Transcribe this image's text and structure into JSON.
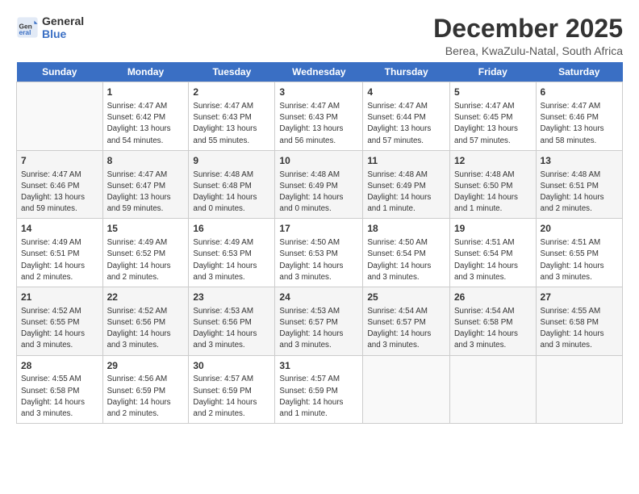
{
  "logo": {
    "line1": "General",
    "line2": "Blue"
  },
  "title": "December 2025",
  "subtitle": "Berea, KwaZulu-Natal, South Africa",
  "days_header": [
    "Sunday",
    "Monday",
    "Tuesday",
    "Wednesday",
    "Thursday",
    "Friday",
    "Saturday"
  ],
  "weeks": [
    [
      {
        "day": "",
        "info": ""
      },
      {
        "day": "1",
        "info": "Sunrise: 4:47 AM\nSunset: 6:42 PM\nDaylight: 13 hours\nand 54 minutes."
      },
      {
        "day": "2",
        "info": "Sunrise: 4:47 AM\nSunset: 6:43 PM\nDaylight: 13 hours\nand 55 minutes."
      },
      {
        "day": "3",
        "info": "Sunrise: 4:47 AM\nSunset: 6:43 PM\nDaylight: 13 hours\nand 56 minutes."
      },
      {
        "day": "4",
        "info": "Sunrise: 4:47 AM\nSunset: 6:44 PM\nDaylight: 13 hours\nand 57 minutes."
      },
      {
        "day": "5",
        "info": "Sunrise: 4:47 AM\nSunset: 6:45 PM\nDaylight: 13 hours\nand 57 minutes."
      },
      {
        "day": "6",
        "info": "Sunrise: 4:47 AM\nSunset: 6:46 PM\nDaylight: 13 hours\nand 58 minutes."
      }
    ],
    [
      {
        "day": "7",
        "info": "Sunrise: 4:47 AM\nSunset: 6:46 PM\nDaylight: 13 hours\nand 59 minutes."
      },
      {
        "day": "8",
        "info": "Sunrise: 4:47 AM\nSunset: 6:47 PM\nDaylight: 13 hours\nand 59 minutes."
      },
      {
        "day": "9",
        "info": "Sunrise: 4:48 AM\nSunset: 6:48 PM\nDaylight: 14 hours\nand 0 minutes."
      },
      {
        "day": "10",
        "info": "Sunrise: 4:48 AM\nSunset: 6:49 PM\nDaylight: 14 hours\nand 0 minutes."
      },
      {
        "day": "11",
        "info": "Sunrise: 4:48 AM\nSunset: 6:49 PM\nDaylight: 14 hours\nand 1 minute."
      },
      {
        "day": "12",
        "info": "Sunrise: 4:48 AM\nSunset: 6:50 PM\nDaylight: 14 hours\nand 1 minute."
      },
      {
        "day": "13",
        "info": "Sunrise: 4:48 AM\nSunset: 6:51 PM\nDaylight: 14 hours\nand 2 minutes."
      }
    ],
    [
      {
        "day": "14",
        "info": "Sunrise: 4:49 AM\nSunset: 6:51 PM\nDaylight: 14 hours\nand 2 minutes."
      },
      {
        "day": "15",
        "info": "Sunrise: 4:49 AM\nSunset: 6:52 PM\nDaylight: 14 hours\nand 2 minutes."
      },
      {
        "day": "16",
        "info": "Sunrise: 4:49 AM\nSunset: 6:53 PM\nDaylight: 14 hours\nand 3 minutes."
      },
      {
        "day": "17",
        "info": "Sunrise: 4:50 AM\nSunset: 6:53 PM\nDaylight: 14 hours\nand 3 minutes."
      },
      {
        "day": "18",
        "info": "Sunrise: 4:50 AM\nSunset: 6:54 PM\nDaylight: 14 hours\nand 3 minutes."
      },
      {
        "day": "19",
        "info": "Sunrise: 4:51 AM\nSunset: 6:54 PM\nDaylight: 14 hours\nand 3 minutes."
      },
      {
        "day": "20",
        "info": "Sunrise: 4:51 AM\nSunset: 6:55 PM\nDaylight: 14 hours\nand 3 minutes."
      }
    ],
    [
      {
        "day": "21",
        "info": "Sunrise: 4:52 AM\nSunset: 6:55 PM\nDaylight: 14 hours\nand 3 minutes."
      },
      {
        "day": "22",
        "info": "Sunrise: 4:52 AM\nSunset: 6:56 PM\nDaylight: 14 hours\nand 3 minutes."
      },
      {
        "day": "23",
        "info": "Sunrise: 4:53 AM\nSunset: 6:56 PM\nDaylight: 14 hours\nand 3 minutes."
      },
      {
        "day": "24",
        "info": "Sunrise: 4:53 AM\nSunset: 6:57 PM\nDaylight: 14 hours\nand 3 minutes."
      },
      {
        "day": "25",
        "info": "Sunrise: 4:54 AM\nSunset: 6:57 PM\nDaylight: 14 hours\nand 3 minutes."
      },
      {
        "day": "26",
        "info": "Sunrise: 4:54 AM\nSunset: 6:58 PM\nDaylight: 14 hours\nand 3 minutes."
      },
      {
        "day": "27",
        "info": "Sunrise: 4:55 AM\nSunset: 6:58 PM\nDaylight: 14 hours\nand 3 minutes."
      }
    ],
    [
      {
        "day": "28",
        "info": "Sunrise: 4:55 AM\nSunset: 6:58 PM\nDaylight: 14 hours\nand 3 minutes."
      },
      {
        "day": "29",
        "info": "Sunrise: 4:56 AM\nSunset: 6:59 PM\nDaylight: 14 hours\nand 2 minutes."
      },
      {
        "day": "30",
        "info": "Sunrise: 4:57 AM\nSunset: 6:59 PM\nDaylight: 14 hours\nand 2 minutes."
      },
      {
        "day": "31",
        "info": "Sunrise: 4:57 AM\nSunset: 6:59 PM\nDaylight: 14 hours\nand 1 minute."
      },
      {
        "day": "",
        "info": ""
      },
      {
        "day": "",
        "info": ""
      },
      {
        "day": "",
        "info": ""
      }
    ]
  ]
}
